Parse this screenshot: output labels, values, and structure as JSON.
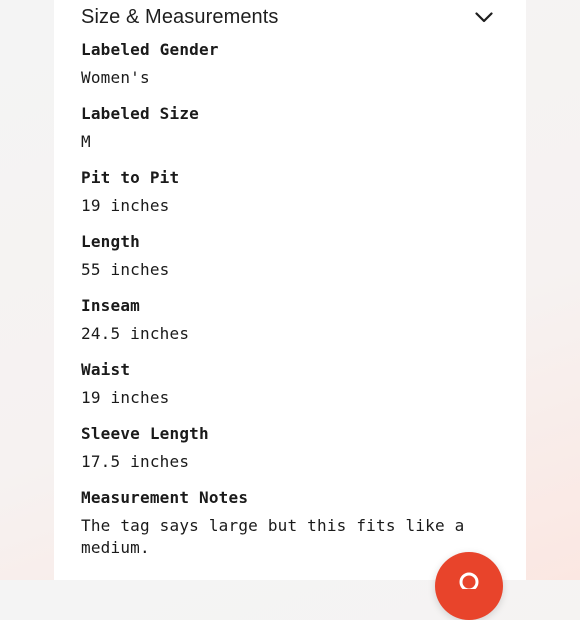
{
  "section": {
    "title": "Size & Measurements",
    "toggle_icon": "chevron-down-icon"
  },
  "fields": [
    {
      "label": "Labeled Gender",
      "value": "Women's"
    },
    {
      "label": "Labeled Size",
      "value": "M"
    },
    {
      "label": "Pit to Pit",
      "value": "19 inches"
    },
    {
      "label": "Length",
      "value": "55 inches"
    },
    {
      "label": "Inseam",
      "value": "24.5 inches"
    },
    {
      "label": "Waist",
      "value": "19 inches"
    },
    {
      "label": "Sleeve Length",
      "value": "17.5 inches"
    },
    {
      "label": "Measurement Notes",
      "value": "The tag says large but this fits like a medium."
    }
  ],
  "fab": {
    "icon": "chat-icon",
    "color": "#e8442b"
  },
  "colors": {
    "text": "#1a1a1a",
    "accent": "#e8442b",
    "card_bg": "#ffffff"
  }
}
